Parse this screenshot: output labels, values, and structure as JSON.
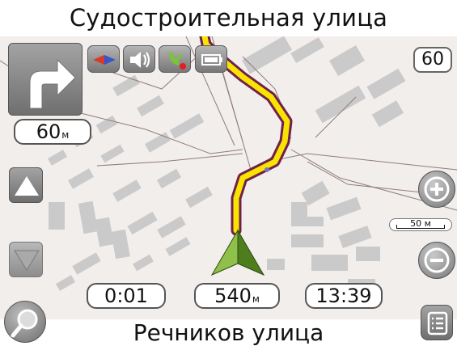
{
  "header": {
    "street": "Судостроительная улица"
  },
  "footer": {
    "street": "Речников улица"
  },
  "maneuver": {
    "distance_value": "60",
    "distance_unit": "м",
    "icon": "turn-right-arrow-icon"
  },
  "speed_limit": "60",
  "status_icons": [
    "compass-icon",
    "volume-icon",
    "gps-signal-icon",
    "battery-icon"
  ],
  "info": {
    "elapsed_time": "0:01",
    "distance_value": "540",
    "distance_unit": "м",
    "clock": "13:39"
  },
  "scale": {
    "label": "50 м"
  },
  "colors": {
    "route": "#f8e400",
    "route_border": "#70214a",
    "vehicle": "#4e7d1d",
    "map_background": "#f2eeec"
  }
}
